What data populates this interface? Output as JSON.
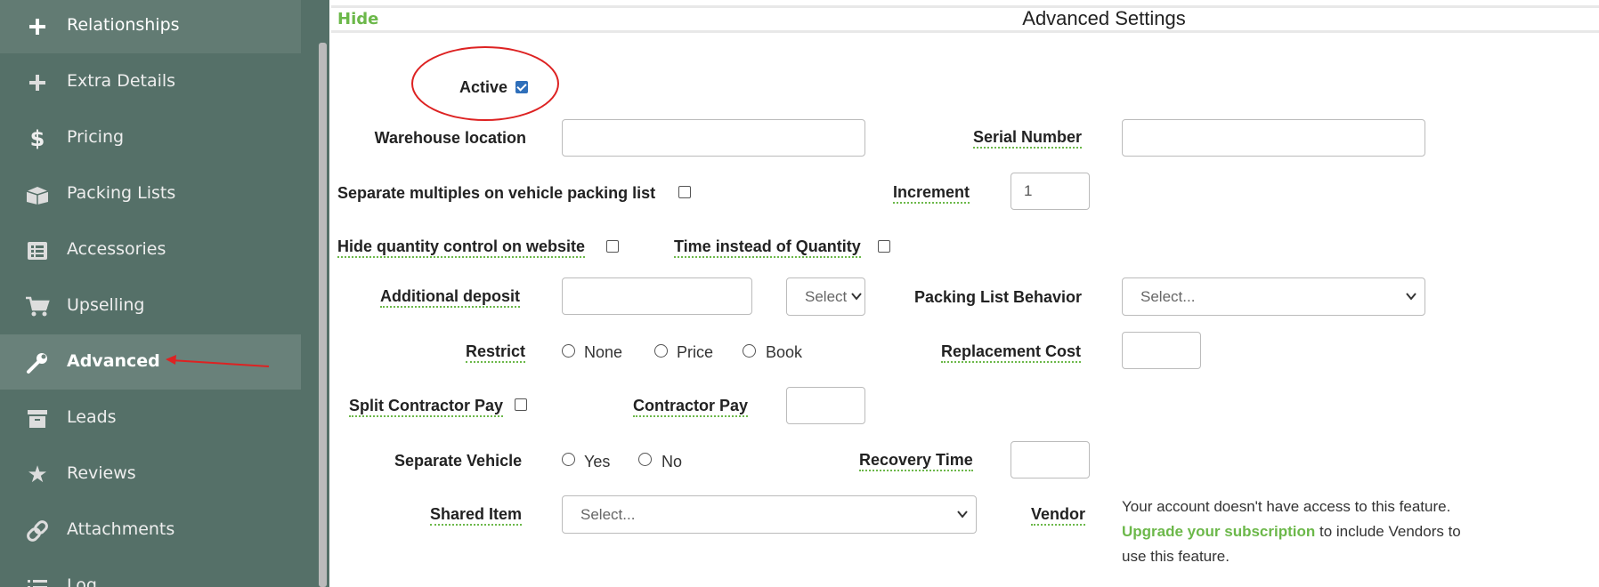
{
  "sidebar": {
    "items": [
      {
        "label": "Relationships",
        "icon": "plus-icon"
      },
      {
        "label": "Extra Details",
        "icon": "plus-icon"
      },
      {
        "label": "Pricing",
        "icon": "dollar-icon"
      },
      {
        "label": "Packing Lists",
        "icon": "box-icon"
      },
      {
        "label": "Accessories",
        "icon": "list-icon"
      },
      {
        "label": "Upselling",
        "icon": "cart-icon"
      },
      {
        "label": "Advanced",
        "icon": "wrench-icon"
      },
      {
        "label": "Leads",
        "icon": "archive-icon"
      },
      {
        "label": "Reviews",
        "icon": "star-icon"
      },
      {
        "label": "Attachments",
        "icon": "link-icon"
      },
      {
        "label": "Log",
        "icon": "list-lines-icon"
      }
    ],
    "active": "Advanced"
  },
  "header": {
    "hide_label": "Hide",
    "title": "Advanced Settings"
  },
  "form": {
    "active_label": "Active",
    "warehouse_location_label": "Warehouse location",
    "serial_number_label": "Serial Number",
    "separate_multiples_label": "Separate multiples on vehicle packing list",
    "increment_label": "Increment",
    "increment_value": "1",
    "hide_quantity_label": "Hide quantity control on website",
    "time_instead_label": "Time instead of Quantity",
    "additional_deposit_label": "Additional deposit",
    "deposit_type_value": "Select",
    "packing_list_behavior_label": "Packing List Behavior",
    "packing_list_behavior_value": "Select...",
    "restrict_label": "Restrict",
    "restrict_options": [
      "None",
      "Price",
      "Book"
    ],
    "replacement_cost_label": "Replacement Cost",
    "split_contractor_label": "Split Contractor Pay",
    "contractor_pay_label": "Contractor Pay",
    "separate_vehicle_label": "Separate Vehicle",
    "separate_vehicle_options": [
      "Yes",
      "No"
    ],
    "recovery_time_label": "Recovery Time",
    "shared_item_label": "Shared Item",
    "shared_item_value": "Select...",
    "vendor_label": "Vendor",
    "vendor_notice_1": "Your account doesn't have access to this feature.",
    "vendor_notice_link": "Upgrade your subscription",
    "vendor_notice_2": " to include Vendors to",
    "vendor_notice_3": "use this feature."
  },
  "colors": {
    "sidebar_bg": "#557068",
    "accent_green": "#6cb84a",
    "annotation_red": "#d22222"
  }
}
